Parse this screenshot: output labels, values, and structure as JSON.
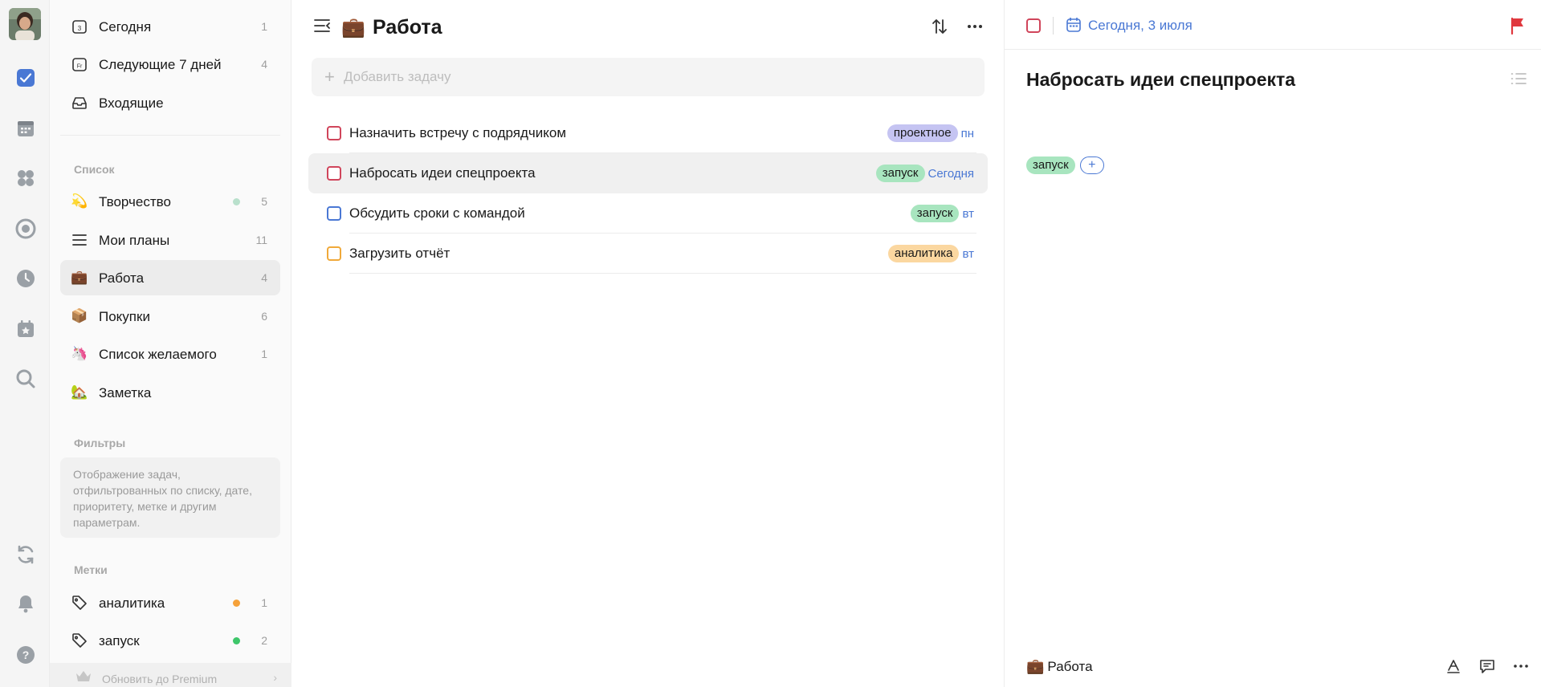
{
  "sidebar": {
    "smart_lists": [
      {
        "label": "Сегодня",
        "count": "1",
        "icon": "calendar-today-icon"
      },
      {
        "label": "Следующие 7 дней",
        "count": "4",
        "icon": "calendar-week-icon"
      },
      {
        "label": "Входящие",
        "count": "",
        "icon": "inbox-icon"
      }
    ],
    "lists_heading": "Список",
    "lists": [
      {
        "label": "Творчество",
        "count": "5",
        "icon": "💫",
        "dot": "#b9e0cc"
      },
      {
        "label": "Мои планы",
        "count": "11",
        "icon": "☰"
      },
      {
        "label": "Работа",
        "count": "4",
        "icon": "💼"
      },
      {
        "label": "Покупки",
        "count": "6",
        "icon": "📦"
      },
      {
        "label": "Список желаемого",
        "count": "1",
        "icon": "🦄"
      },
      {
        "label": "Заметка",
        "count": "",
        "icon": "🏡"
      }
    ],
    "filters_heading": "Фильтры",
    "filters_hint": "Отображение задач, отфильтрованных по списку, дате, приоритету, метке и другим параметрам.",
    "tags_heading": "Метки",
    "tags": [
      {
        "label": "аналитика",
        "count": "1",
        "dot": "#f5a13a"
      },
      {
        "label": "запуск",
        "count": "2",
        "dot": "#3ec66a"
      }
    ],
    "premium_label": "Обновить до Premium"
  },
  "main": {
    "list_icon": "💼",
    "title": "Работа",
    "add_placeholder": "Добавить задачу",
    "tasks": [
      {
        "title": "Назначить встречу с подрядчиком",
        "tag": "проектное",
        "tag_color": "#c5c4f2",
        "due": "пн",
        "priority_color": "#d0455b"
      },
      {
        "title": "Набросать идеи спецпроекта",
        "tag": "запуск",
        "tag_color": "#a8e5bf",
        "due": "Сегодня",
        "priority_color": "#d0455b"
      },
      {
        "title": "Обсудить сроки с командой",
        "tag": "запуск",
        "tag_color": "#a8e5bf",
        "due": "вт",
        "priority_color": "#4a78d4"
      },
      {
        "title": "Загрузить отчёт",
        "tag": "аналитика",
        "tag_color": "#fbd7a0",
        "due": "вт",
        "priority_color": "#f0a93a"
      }
    ]
  },
  "detail": {
    "date": "Сегодня, 3 июля",
    "title": "Набросать идеи спецпроекта",
    "tag": "запуск",
    "tag_color": "#a8e5bf",
    "add_tag": "+",
    "list_icon": "💼",
    "list_name": "Работа",
    "flag_color": "#e0383e"
  },
  "colors": {
    "accent": "#4a78d4",
    "priority_high": "#d0455b"
  }
}
